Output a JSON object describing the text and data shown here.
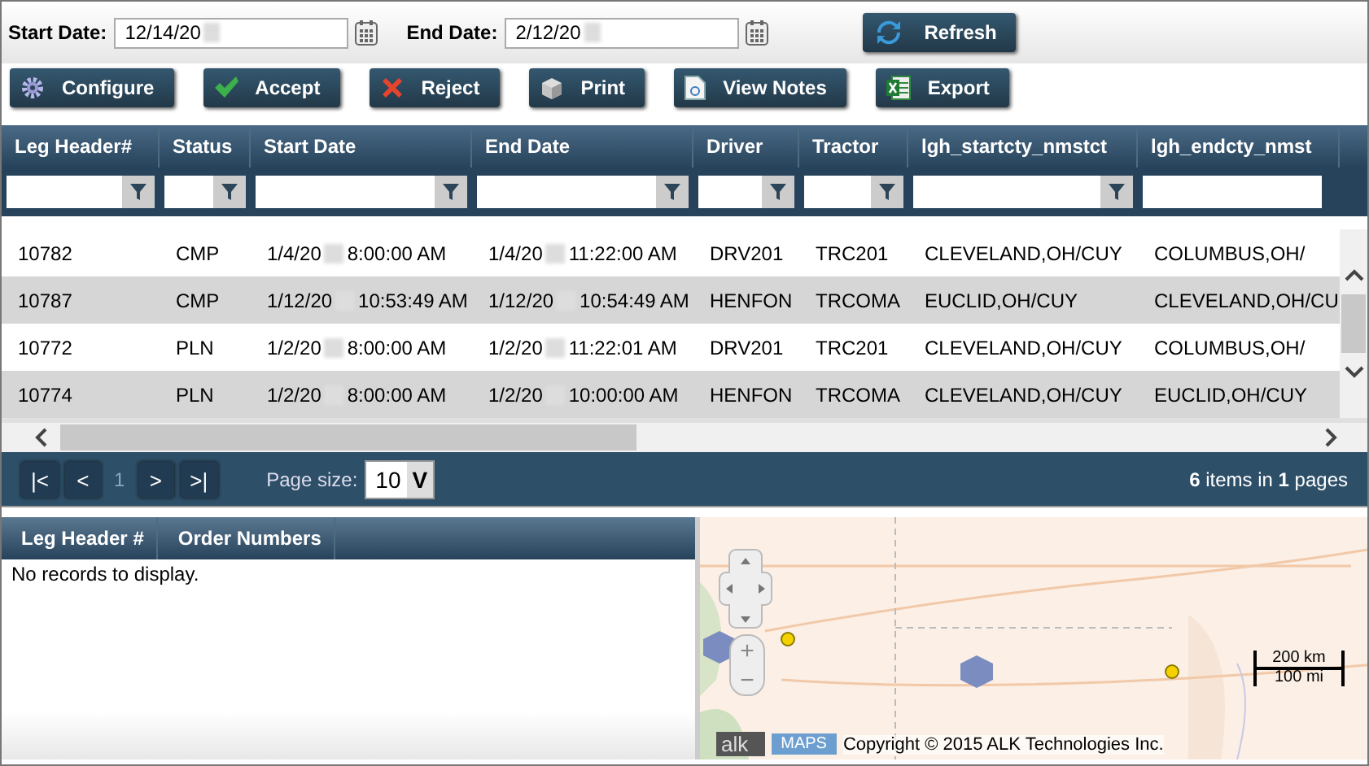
{
  "dates": [
    {
      "label": "Start Date:",
      "value": "12/14/20"
    },
    {
      "label": "End Date:",
      "value": "2/12/20"
    }
  ],
  "refresh_button": {
    "label": "Refresh"
  },
  "toolbar": [
    {
      "kind": "gear",
      "label": "Configure"
    },
    {
      "kind": "check",
      "label": "Accept"
    },
    {
      "kind": "cross",
      "label": "Reject"
    },
    {
      "kind": "print",
      "label": "Print"
    },
    {
      "kind": "notes",
      "label": "View Notes"
    },
    {
      "kind": "sheet",
      "label": "Export"
    }
  ],
  "grid": {
    "columns": [
      "Leg Header#",
      "Status",
      "Start Date",
      "End Date",
      "Driver",
      "Tractor",
      "lgh_startcty_nmstct",
      "lgh_endcty_nmst"
    ],
    "rows": [
      [
        "10782",
        "CMP",
        "1/4/20 8:00:00 AM",
        "1/4/20 11:22:00 AM",
        "DRV201",
        "TRC201",
        "CLEVELAND,OH/CUY",
        "COLUMBUS,OH/"
      ],
      [
        "10787",
        "CMP",
        "1/12/20 10:53:49 AM",
        "1/12/20 10:54:49 AM",
        "HENFON",
        "TRCOMA",
        "EUCLID,OH/CUY",
        "CLEVELAND,OH/CU"
      ],
      [
        "10772",
        "PLN",
        "1/2/20 8:00:00 AM",
        "1/2/20 11:22:01 AM",
        "DRV201",
        "TRC201",
        "CLEVELAND,OH/CUY",
        "COLUMBUS,OH/"
      ],
      [
        "10774",
        "PLN",
        "1/2/20 8:00:00 AM",
        "1/2/20 10:00:00 AM",
        "HENFON",
        "TRCOMA",
        "CLEVELAND,OH/CUY",
        "EUCLID,OH/CUY"
      ]
    ]
  },
  "pager": {
    "buttons": [
      "|<",
      "<",
      ">",
      ">|"
    ],
    "current_page": "1",
    "page_size_label": "Page size:",
    "page_size": "10",
    "page_size_caret": "V",
    "summary": "**6** items in **1** pages"
  },
  "detail_grid": {
    "columns": [
      "Leg Header #",
      "Order Numbers"
    ],
    "empty_message": "No records to display."
  },
  "map": {
    "kind": "picture",
    "zoom_in": "+",
    "zoom_out": "−",
    "scale_km": "200 km",
    "scale_mi": "100 mi",
    "logo_left": "alk",
    "logo_right": "MAPS",
    "copyright": "Copyright © 2015 ALK Technologies Inc."
  }
}
